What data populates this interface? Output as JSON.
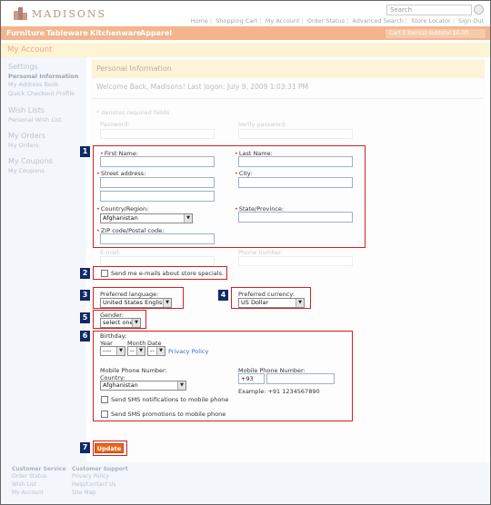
{
  "header": {
    "brand": "MADISONS",
    "search_placeholder": "Search",
    "links": [
      "Home",
      "Shopping Cart",
      "My Account",
      "Order Status",
      "Advanced Search",
      "Store Locator",
      "Sign Out"
    ],
    "nav": [
      "Furniture",
      "Tableware",
      "Kitchenware",
      "Apparel"
    ],
    "cart": "Cart 0 item(s) subtotal $0.00"
  },
  "page_title": "My Account",
  "sidebar": {
    "settings": "Settings",
    "settings_items": [
      "Personal Information",
      "My Address Book",
      "Quick Checkout Profile"
    ],
    "wishlists": "Wish Lists",
    "wishlist_items": [
      "Personal Wish List"
    ],
    "orders": "My Orders",
    "order_items": [
      "My Orders"
    ],
    "coupons": "My Coupons",
    "coupon_items": [
      "My Coupons"
    ]
  },
  "panel": {
    "title": "Personal Information",
    "welcome": "Welcome Back, Madisons! Last logon: July 9, 2009 1:03:31 PM",
    "required_note": "* denotes required fields",
    "password": "Password:",
    "verify_password": "Verify password:",
    "email": "E-mail:",
    "phone": "Phone number:"
  },
  "form": {
    "first_name": "First Name:",
    "last_name": "Last Name:",
    "street": "Street address:",
    "city": "City:",
    "country": "Country/Region:",
    "country_value": "Afghanistan",
    "state": "State/Province:",
    "zip": "ZIP code/Postal code:",
    "specials": "Send me e-mails about store specials.",
    "language": "Preferred language:",
    "language_value": "United States English",
    "currency": "Preferred currency:",
    "currency_value": "US Dollar",
    "gender": "Gender:",
    "gender_value": "select one",
    "birthday": "Birthday:",
    "year": "Year",
    "month": "Month",
    "date": "Date",
    "year_value": "----",
    "month_value": "--",
    "date_value": "--",
    "privacy": "Privacy Policy",
    "mobile_label": "Mobile Phone Number:",
    "mobile_country": "Country:",
    "mobile_country_value": "Afghanistan",
    "mobile_label2": "Mobile Phone Number:",
    "mobile_code": "+93",
    "mobile_example": "Example: +91 1234567890",
    "sms_notifications": "Send SMS notifications to mobile phone",
    "sms_promotions": "Send SMS promotions to mobile phone",
    "update": "Update"
  },
  "badges": [
    "1",
    "2",
    "3",
    "4",
    "5",
    "6",
    "7"
  ],
  "footer": {
    "col1_title": "Customer Service",
    "col1": [
      "Order Status",
      "Wish List",
      "My Account"
    ],
    "col2_title": "Customer Support",
    "col2": [
      "Privacy Policy",
      "Help/Contact Us",
      "Site Map"
    ]
  },
  "colors": {
    "brand": "#b89384",
    "nav": "#f3b48e",
    "highlight": "#d42020",
    "badge": "#0d2a66",
    "button": "#e8681c"
  }
}
